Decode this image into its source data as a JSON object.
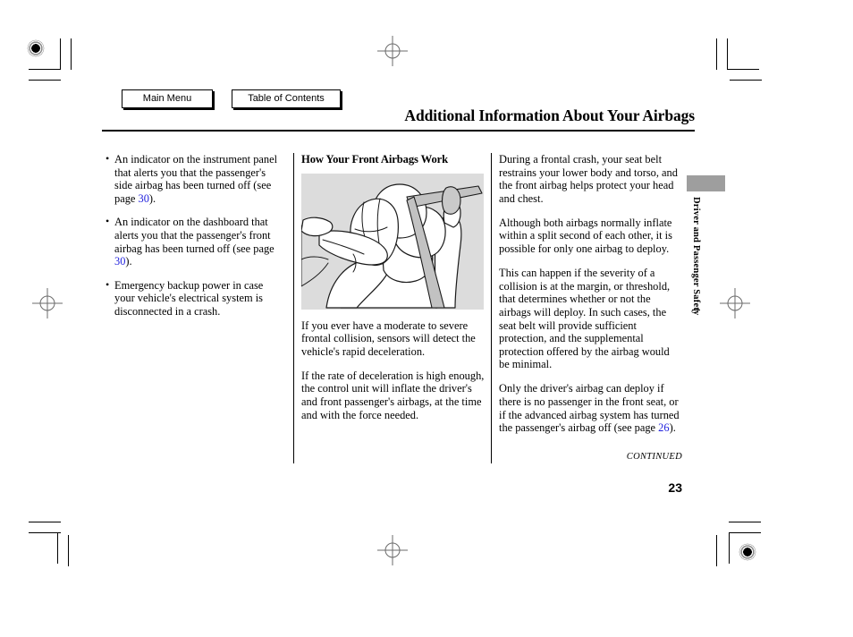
{
  "nav": {
    "main_menu_label": "Main Menu",
    "table_of_contents_label": "Table of Contents"
  },
  "header": {
    "title": "Additional Information About Your Airbags"
  },
  "side_tab": {
    "label": "Driver and Passenger Safety"
  },
  "columns": {
    "left": {
      "bullets": [
        "An indicator on the instrument panel that alerts you that the passenger's side airbag has been turned off (see page",
        "An indicator on the dashboard that alerts you that the passenger's front airbag has been turned off (see page",
        "Emergency backup power in case your vehicle's electrical system is disconnected in a crash."
      ],
      "ref_page_1": "30",
      "ref_page_1_tail": ").",
      "ref_page_2": "30",
      "ref_page_2_tail": ")."
    },
    "middle": {
      "heading": "How Your Front Airbags Work",
      "figure_alt": "front-airbag-deployment-illustration",
      "paragraphs": [
        "If you ever have a moderate to severe frontal collision, sensors will detect the vehicle's rapid deceleration.",
        "If the rate of deceleration is high enough, the control unit will inflate the driver's and front passenger's airbags, at the time and with the force needed."
      ]
    },
    "right": {
      "paragraphs": [
        "During a frontal crash, your seat belt restrains your lower body and torso, and the front airbag helps protect your head and chest.",
        "Although both airbags normally inflate within a split second of each other, it is possible for only one airbag to deploy.",
        "This can happen if the severity of a collision is at the margin, or threshold, that determines whether or not the airbags will deploy. In such cases, the seat belt will provide sufficient protection, and the supplemental protection offered by the airbag would be minimal."
      ],
      "last_paragraph_head": "Only the driver's airbag can deploy if there is no passenger in the front seat, or if the advanced airbag system has turned the passenger's airbag off (see page",
      "ref_page": "26",
      "last_paragraph_tail": ")."
    }
  },
  "footer": {
    "continued_label": "CONTINUED",
    "page_number": "23"
  },
  "colors": {
    "page_reference_link": "#2222dd",
    "figure_background": "#dcdcdc",
    "side_tab_block": "#9e9e9e"
  }
}
